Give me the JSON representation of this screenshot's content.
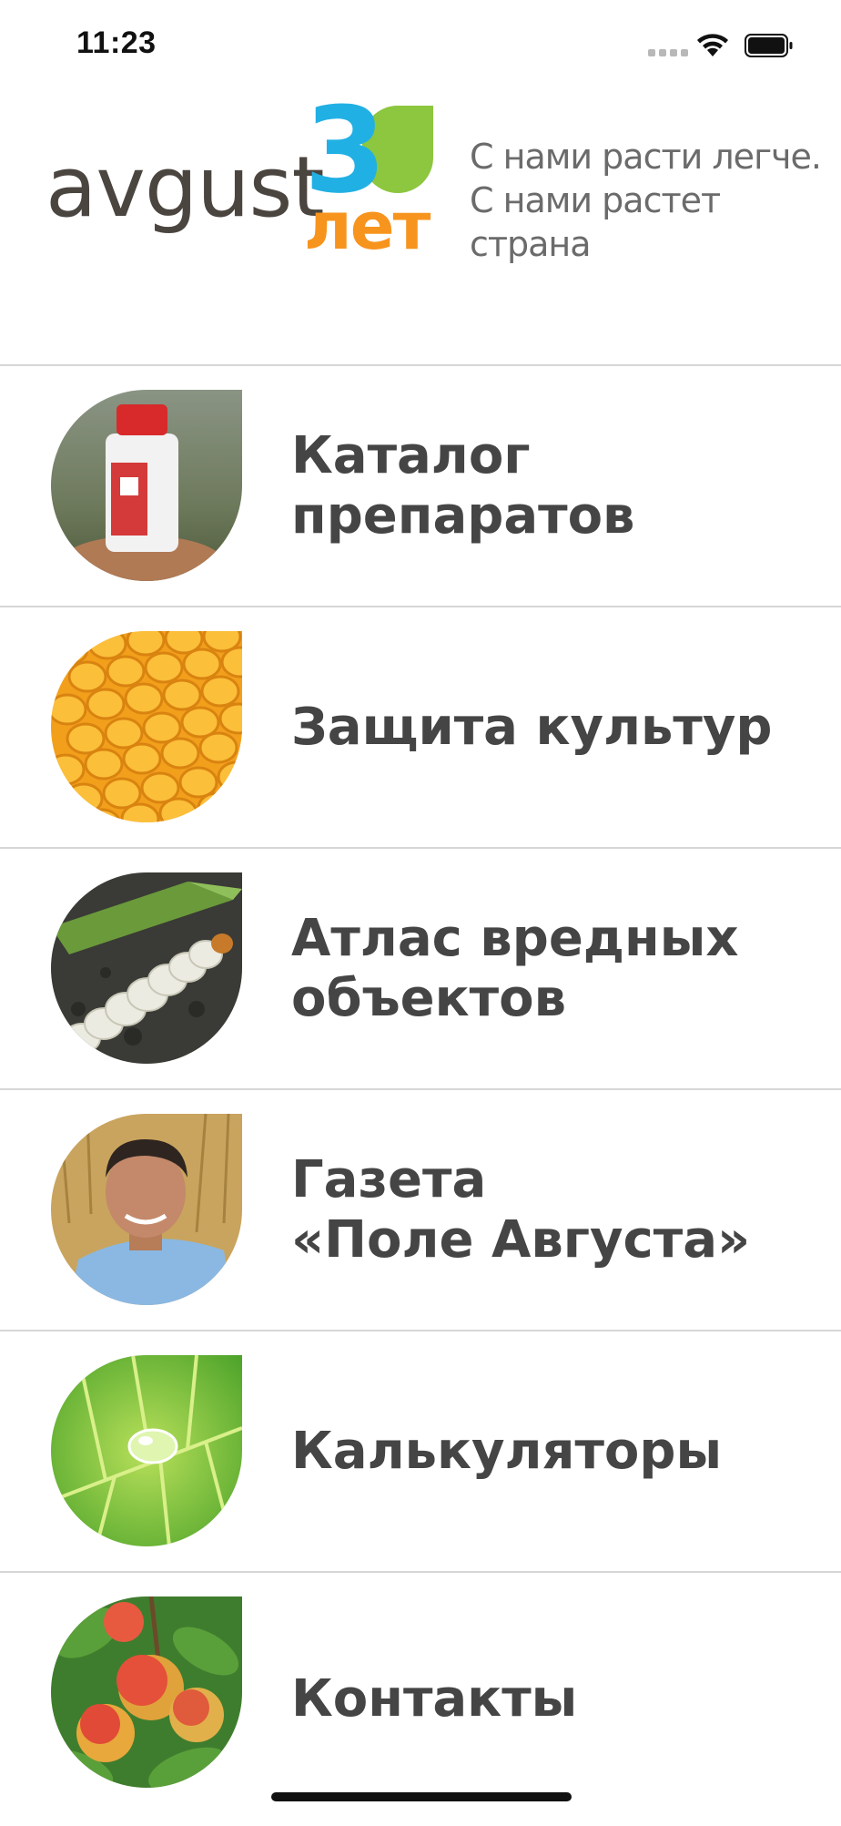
{
  "status_bar": {
    "time": "11:23"
  },
  "header": {
    "brand": "avgust",
    "anniversary_number": "3",
    "anniversary_word": "лет",
    "slogan_line1": "С нами расти легче.",
    "slogan_line2": "С нами растет страна",
    "colors": {
      "brand": "#4b4540",
      "number": "#21b0e4",
      "leaf": "#8dc63f",
      "word": "#f7941d"
    }
  },
  "menu": {
    "items": [
      {
        "lines": [
          "Каталог препаратов"
        ],
        "icon": "product-bottle-image"
      },
      {
        "lines": [
          "Защита культур"
        ],
        "icon": "corn-cob-image"
      },
      {
        "lines": [
          "Атлас вредных",
          "объектов"
        ],
        "icon": "larva-image"
      },
      {
        "lines": [
          "Газета",
          "«Поле Августа»"
        ],
        "icon": "man-in-field-image"
      },
      {
        "lines": [
          "Калькуляторы"
        ],
        "icon": "leaf-droplet-image"
      },
      {
        "lines": [
          "Контакты"
        ],
        "icon": "apples-image"
      }
    ]
  }
}
